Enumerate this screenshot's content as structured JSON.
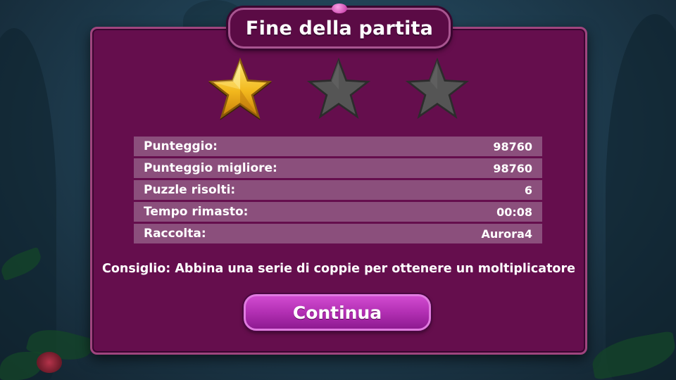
{
  "dialog": {
    "title": "Fine della partita",
    "stars_earned": 1,
    "stars_total": 3,
    "colors": {
      "panel": "#650e4d",
      "row": "#8b4f7c",
      "star_gold": "#f2b81d",
      "star_empty": "#555555",
      "button": "#b22fb3"
    }
  },
  "stats": [
    {
      "label": "Punteggio:",
      "value": "98760"
    },
    {
      "label": "Punteggio migliore:",
      "value": "98760"
    },
    {
      "label": "Puzzle risolti:",
      "value": "6"
    },
    {
      "label": "Tempo rimasto:",
      "value": "00:08"
    },
    {
      "label": "Raccolta:",
      "value": "Aurora4"
    }
  ],
  "tip": "Consiglio: Abbina una serie di coppie per ottenere un moltiplicatore",
  "buttons": {
    "continue_label": "Continua"
  },
  "icons": {
    "star_filled": "star-filled-icon",
    "star_empty": "star-empty-icon"
  }
}
